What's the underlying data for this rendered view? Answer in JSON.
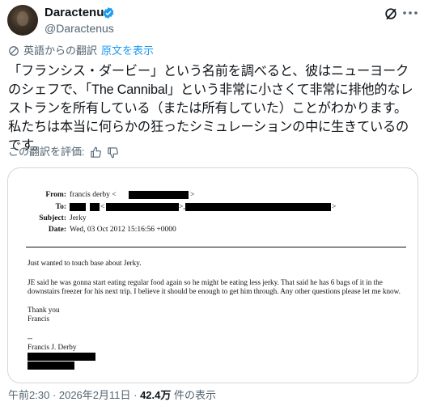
{
  "author": {
    "display_name": "Daractenus",
    "handle": "@Daractenus"
  },
  "translation": {
    "label": "英語からの翻訳",
    "show_original": "原文を表示",
    "rate": "この翻訳を評価:"
  },
  "tweet": {
    "text": "「フランシス・ダービー」という名前を調べると、彼はニューヨークのシェフで、「The Cannibal」という非常に小さくて非常に排他的なレストランを所有している（または所有していた）ことがわかります。私たちは本当に何らかの狂ったシミュレーションの中に生きているのです。"
  },
  "email": {
    "from_label": "From:",
    "from_value": "francis derby <",
    "to_label": "To:",
    "subject_label": "Subject:",
    "subject_value": "Jerky",
    "date_label": "Date:",
    "date_value": "Wed, 03 Oct 2012 15:16:56 +0000",
    "line1": "Just wanted to touch base about Jerky.",
    "para2": "JE said he was gonna start eating regular food again so he might be eating less jerky. That said he has 6 bags of it in the downstairs freezer for his next trip. I believe it should be enough to get him through. Any other questions please let me know.",
    "thanks": "Thank you",
    "name1": "Francis",
    "sig_dash": "--",
    "sig_name": "Francis J. Derby"
  },
  "meta": {
    "time": "午前2:30 · 2026年2月11日 · ",
    "views": "42.4万",
    "views_suffix": " 件の表示"
  },
  "colors": {
    "accent": "#1d9bf0",
    "secondary": "#536471",
    "border": "#cfd9de"
  },
  "icons": [
    "verified-badge-icon",
    "grok-icon",
    "more-icon",
    "translate-icon",
    "thumbs-up-icon",
    "thumbs-down-icon"
  ]
}
